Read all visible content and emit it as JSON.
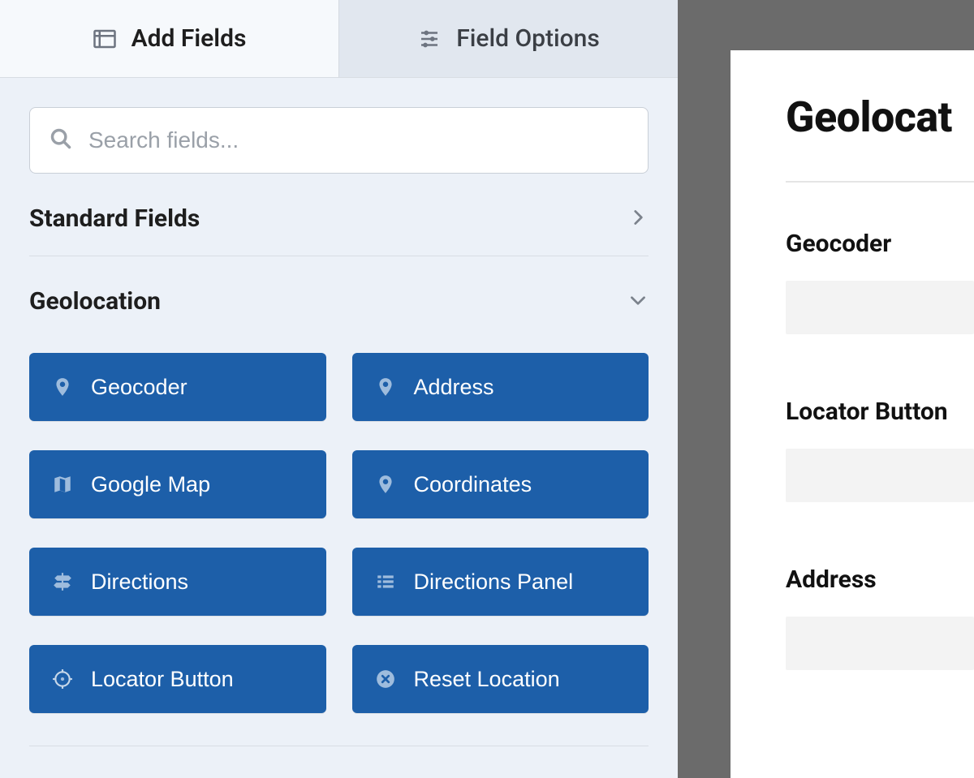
{
  "tabs": {
    "add_fields": "Add Fields",
    "field_options": "Field Options"
  },
  "search": {
    "placeholder": "Search fields..."
  },
  "sections": {
    "standard": {
      "title": "Standard Fields"
    },
    "geolocation": {
      "title": "Geolocation",
      "fields": [
        {
          "label": "Geocoder",
          "icon": "pin-icon"
        },
        {
          "label": "Address",
          "icon": "pin-icon"
        },
        {
          "label": "Google Map",
          "icon": "map-icon"
        },
        {
          "label": "Coordinates",
          "icon": "pin-icon"
        },
        {
          "label": "Directions",
          "icon": "signpost-icon"
        },
        {
          "label": "Directions Panel",
          "icon": "list-icon"
        },
        {
          "label": "Locator Button",
          "icon": "crosshair-icon"
        },
        {
          "label": "Reset Location",
          "icon": "close-circle-icon"
        }
      ]
    }
  },
  "preview": {
    "title": "Geolocat",
    "fields": [
      {
        "label": "Geocoder"
      },
      {
        "label": "Locator Button"
      },
      {
        "label": "Address"
      }
    ]
  },
  "colors": {
    "button_bg": "#1d5fa9",
    "sidebar_bg": "#ecf1f8",
    "outer_bg": "#6b6b6b"
  }
}
